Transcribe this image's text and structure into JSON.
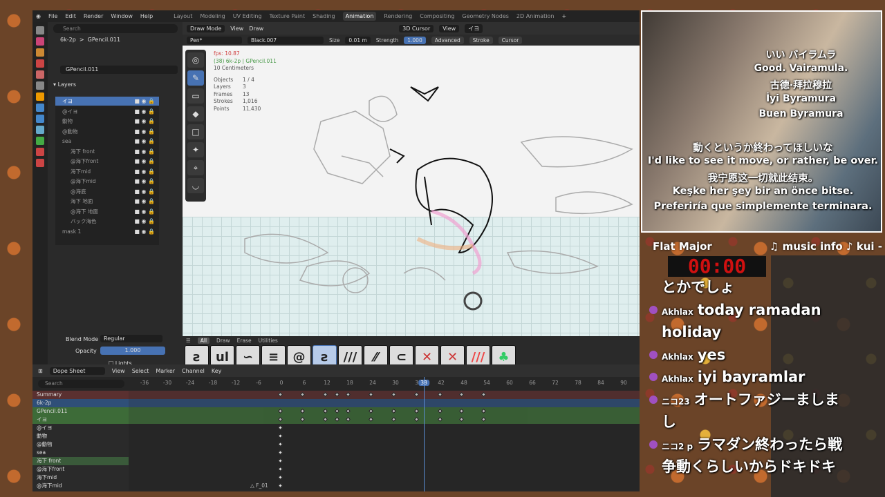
{
  "menu": {
    "items": [
      "File",
      "Edit",
      "Render",
      "Window",
      "Help"
    ],
    "workspaces": [
      "Layout",
      "Modeling",
      "UV Editing",
      "Texture Paint",
      "Shading",
      "Animation",
      "Rendering",
      "Compositing",
      "Geometry Nodes",
      "2D Animation"
    ],
    "active_workspace": "Animation"
  },
  "props": {
    "scene": "6k-2p",
    "object": "GPencil.011",
    "data": "GPencil.011",
    "search_placeholder": "Search",
    "layers_title": "Layers",
    "layers": [
      {
        "name": "イヨ",
        "active": true
      },
      {
        "name": "@イヨ"
      },
      {
        "name": "動物"
      },
      {
        "name": "@動物"
      },
      {
        "name": "sea"
      },
      {
        "name": "海下 front"
      },
      {
        "name": "@海下front"
      },
      {
        "name": "海下mid"
      },
      {
        "name": "@海下mid"
      },
      {
        "name": "@海底"
      },
      {
        "name": "海下 地面"
      },
      {
        "name": "@海下 地面"
      },
      {
        "name": "バック海色"
      },
      {
        "name": "mask 1"
      }
    ],
    "blend_mode_label": "Blend Mode",
    "blend_mode": "Regular",
    "opacity_label": "Opacity",
    "opacity": "1.000",
    "lights_label": "Lights"
  },
  "viewport": {
    "mode": "Draw Mode",
    "view": "View",
    "draw": "Draw",
    "cursor": "3D Cursor",
    "view2": "View",
    "layer": "イヨ",
    "brush": "Pen*",
    "material": "Black.007",
    "size_label": "Size",
    "size": "0.01 m",
    "strength_label": "Strength",
    "strength": "1.000",
    "advanced": "Advanced",
    "stroke": "Stroke",
    "cursor2": "Cursor",
    "stats": {
      "fps": "fps: 10.87",
      "object_line": "(38) 6k-2p | GPencil.011",
      "scale": "10 Centimeters",
      "objects": "1 / 4",
      "layers": "3",
      "frames": "13",
      "strokes": "1,016",
      "points": "11,430"
    },
    "stat_labels": {
      "objects": "Objects",
      "layers": "Layers",
      "frames": "Frames",
      "strokes": "Strokes",
      "points": "Points"
    }
  },
  "brushbar": {
    "tabs": [
      "All",
      "Draw",
      "Erase",
      "Utilities"
    ],
    "active_tab": "All"
  },
  "dopesheet": {
    "editor": "Dope Sheet",
    "menus": [
      "View",
      "Select",
      "Marker",
      "Channel",
      "Key"
    ],
    "search_placeholder": "Search",
    "ruler": [
      "-36",
      "-30",
      "-24",
      "-18",
      "-12",
      "-6",
      "0",
      "6",
      "12",
      "18",
      "24",
      "30",
      "36",
      "42",
      "48",
      "54",
      "60",
      "66",
      "72",
      "78",
      "84",
      "90"
    ],
    "current_frame": "38",
    "channels": [
      "Summary",
      "6k-2p",
      "GPencil.011",
      "イヨ",
      "@イヨ",
      "動物",
      "@動物",
      "sea",
      "海下 front",
      "@海下front",
      "海下mid",
      "@海下mid"
    ],
    "marker": "F_01"
  },
  "webcam": {
    "subtitles_top": [
      "いい バイラムラ",
      "Good. Vairamula.",
      "古德·拜拉穆拉",
      "İyi Byramura",
      "Buen Byramura"
    ],
    "subtitles_bottom": [
      "動くというか終わってほしいな",
      "I'd like to see it move, or rather, be over.",
      "我宁愿这一切就此结束。",
      "Keşke her şey bir an önce bitse.",
      "Preferiría que simplemente terminara."
    ]
  },
  "music": {
    "left": "Flat Major",
    "right": "♫ music info ♪  kui -"
  },
  "timer": "00:00",
  "chat": [
    {
      "name": "",
      "text": "とかでしょ"
    },
    {
      "name": "Akhlax",
      "text": "today ramadan"
    },
    {
      "name": "",
      "text": "holiday"
    },
    {
      "name": "Akhlax",
      "text": "yes"
    },
    {
      "name": "Akhlax",
      "text": "iyi bayramlar"
    },
    {
      "name": "ニコ23",
      "text": "オートファジーましま"
    },
    {
      "name": "",
      "text": "し"
    },
    {
      "name": "ニコ2 p",
      "text": "ラマダン終わったら戦"
    },
    {
      "name": "",
      "text": "争動くらしいからドキドキ"
    }
  ]
}
